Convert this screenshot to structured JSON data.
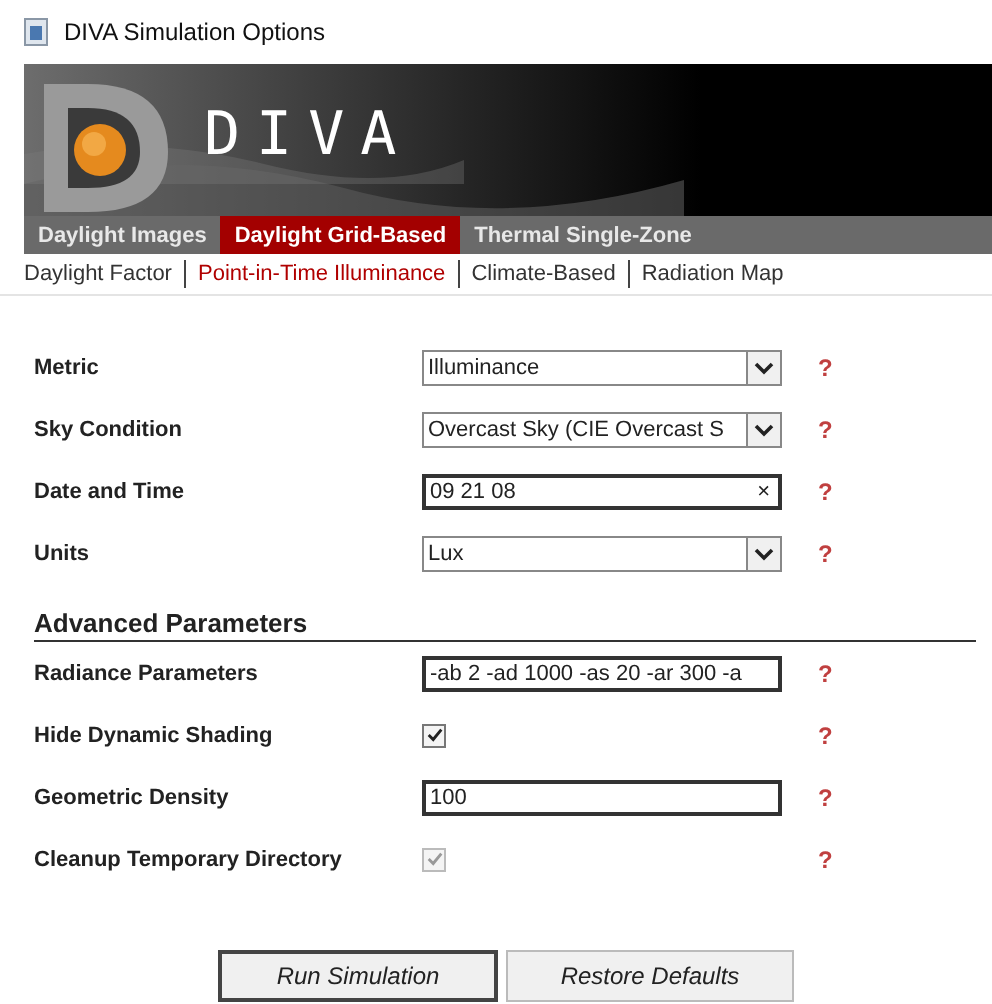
{
  "window": {
    "title": "DIVA Simulation Options"
  },
  "banner": {
    "kind": "picture",
    "logo_text": "DIVA"
  },
  "tabs": [
    {
      "label": "Daylight Images",
      "selected": false
    },
    {
      "label": "Daylight Grid-Based",
      "selected": true
    },
    {
      "label": "Thermal Single-Zone",
      "selected": false
    }
  ],
  "subtabs": [
    {
      "label": "Daylight Factor",
      "selected": false
    },
    {
      "label": "Point-in-Time Illuminance",
      "selected": true
    },
    {
      "label": "Climate-Based",
      "selected": false
    },
    {
      "label": "Radiation Map",
      "selected": false
    }
  ],
  "fields": [
    {
      "label": "Metric",
      "kind": "select",
      "value": "Illuminance",
      "help": "?"
    },
    {
      "label": "Sky Condition",
      "kind": "select",
      "value": "Overcast Sky (CIE Overcast S",
      "help": "?"
    },
    {
      "label": "Date and Time",
      "kind": "clearable",
      "value": "09 21 08",
      "clear": "×",
      "help": "?"
    },
    {
      "label": "Units",
      "kind": "select",
      "value": "Lux",
      "help": "?"
    }
  ],
  "advanced": {
    "heading": "Advanced Parameters",
    "fields": [
      {
        "label": "Radiance Parameters",
        "kind": "text",
        "value": "-ab 2 -ad 1000 -as 20 -ar 300 -a",
        "help": "?"
      },
      {
        "label": "Hide Dynamic Shading",
        "kind": "checkbox",
        "checked": true,
        "disabled": false,
        "help": "?"
      },
      {
        "label": "Geometric Density",
        "kind": "text",
        "value": "100",
        "help": "?"
      },
      {
        "label": "Cleanup Temporary Directory",
        "kind": "checkbox",
        "checked": true,
        "disabled": true,
        "help": "?"
      }
    ]
  },
  "buttons": [
    {
      "label": "Run Simulation",
      "selected": true
    },
    {
      "label": "Restore Defaults",
      "selected": false
    }
  ]
}
